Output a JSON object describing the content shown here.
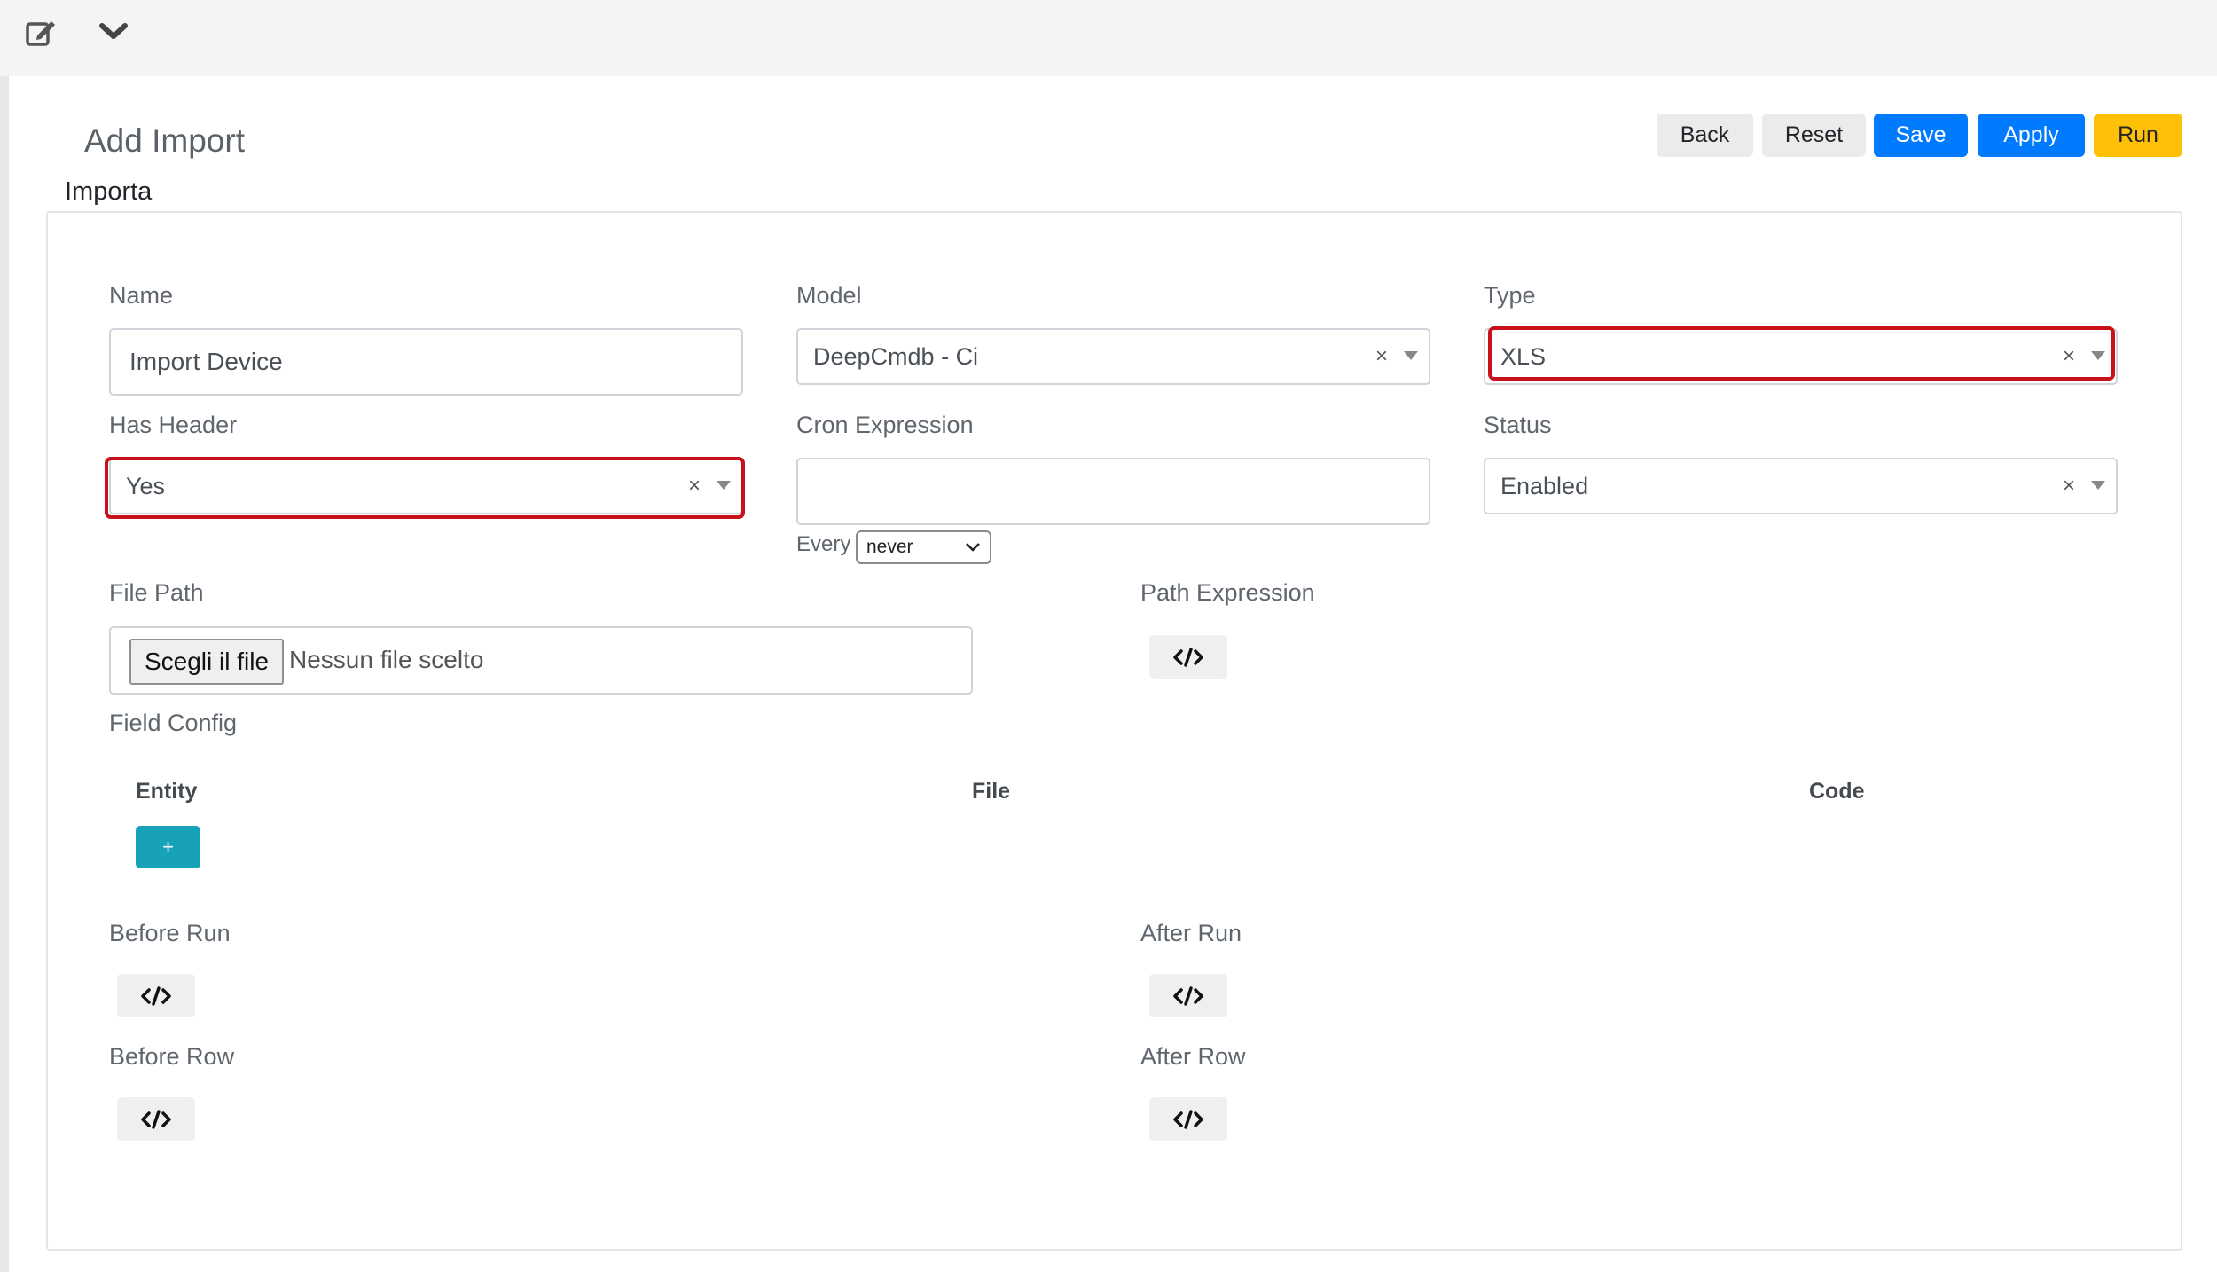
{
  "toolbar": {
    "edit_icon": "edit-icon",
    "collapse_icon": "chevron-down-icon"
  },
  "header": {
    "title": "Add Import"
  },
  "actions": {
    "back": "Back",
    "reset": "Reset",
    "save": "Save",
    "apply": "Apply",
    "run": "Run"
  },
  "section": {
    "title": "Importa"
  },
  "form": {
    "name": {
      "label": "Name",
      "value": "Import Device"
    },
    "model": {
      "label": "Model",
      "value": "DeepCmdb - Ci"
    },
    "type": {
      "label": "Type",
      "value": "XLS"
    },
    "has_header": {
      "label": "Has Header",
      "value": "Yes"
    },
    "cron": {
      "label": "Cron Expression",
      "value": "",
      "every_label": "Every",
      "every_value": "never"
    },
    "status": {
      "label": "Status",
      "value": "Enabled"
    },
    "file_path": {
      "label": "File Path",
      "button": "Scegli il file",
      "no_file": "Nessun file scelto"
    },
    "path_expression": {
      "label": "Path Expression"
    },
    "field_config": {
      "label": "Field Config",
      "columns": [
        "Entity",
        "File",
        "Code"
      ],
      "add_label": "+"
    },
    "before_run": {
      "label": "Before Run"
    },
    "after_run": {
      "label": "After Run"
    },
    "before_row": {
      "label": "Before Row"
    },
    "after_row": {
      "label": "After Row"
    }
  },
  "colors": {
    "primary": "#007bff",
    "warning": "#ffc107",
    "info": "#17a2b8",
    "highlight": "#c8111b"
  }
}
